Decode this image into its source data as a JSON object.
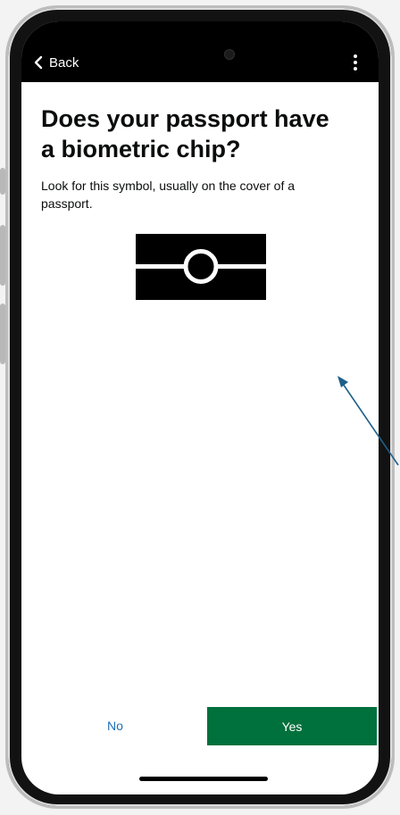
{
  "nav": {
    "back_label": "Back"
  },
  "question": {
    "title": "Does your passport have a biometric chip?",
    "hint": "Look for this symbol, usually on the cover of a passport."
  },
  "actions": {
    "no_label": "No",
    "yes_label": "Yes"
  },
  "icons": {
    "back": "chevron-left-icon",
    "more": "more-vertical-icon",
    "chip": "biometric-chip-symbol"
  },
  "colors": {
    "primary_button": "#00703c",
    "link": "#1d70b8",
    "text": "#0b0c0c",
    "arrow": "#1f5f8a"
  }
}
